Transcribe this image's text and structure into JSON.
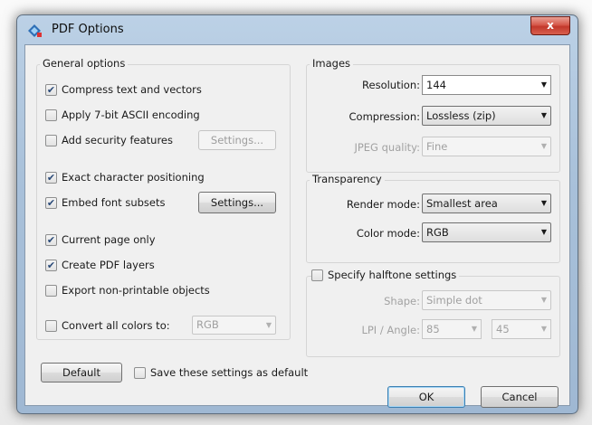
{
  "window": {
    "title": "PDF Options",
    "close_glyph": "x"
  },
  "general": {
    "title": "General options",
    "compress": {
      "label": "Compress text and vectors",
      "checked": true
    },
    "ascii": {
      "label": "Apply 7-bit ASCII encoding",
      "checked": false
    },
    "security": {
      "label": "Add security features",
      "checked": false,
      "button": "Settings..."
    },
    "exact": {
      "label": "Exact character positioning",
      "checked": true
    },
    "embed": {
      "label": "Embed font subsets",
      "checked": true,
      "button": "Settings..."
    },
    "current_page": {
      "label": "Current page only",
      "checked": true
    },
    "layers": {
      "label": "Create PDF layers",
      "checked": true
    },
    "nonprintable": {
      "label": "Export non-printable objects",
      "checked": false
    },
    "convert": {
      "label": "Convert all colors to:",
      "checked": false,
      "value": "RGB"
    }
  },
  "images": {
    "title": "Images",
    "resolution_label": "Resolution:",
    "resolution_value": "144",
    "compression_label": "Compression:",
    "compression_value": "Lossless (zip)",
    "jpeg_label": "JPEG quality:",
    "jpeg_value": "Fine"
  },
  "transparency": {
    "title": "Transparency",
    "render_label": "Render mode:",
    "render_value": "Smallest area",
    "color_label": "Color mode:",
    "color_value": "RGB"
  },
  "halftone": {
    "label": "Specify halftone settings",
    "checked": false,
    "shape_label": "Shape:",
    "shape_value": "Simple dot",
    "lpi_label": "LPI / Angle:",
    "lpi_value": "85",
    "angle_value": "45"
  },
  "footer": {
    "default_button": "Default",
    "save_default": {
      "label": "Save these settings as default",
      "checked": false
    },
    "ok_button": "OK",
    "cancel_button": "Cancel"
  },
  "colors": {
    "accent": "#3c7fb1",
    "title_bar": "#a9c1da",
    "close_button": "#c2382b"
  },
  "icons": {
    "check": "check-mark",
    "arrow": "dropdown-arrow",
    "app": "pdf-app-icon"
  }
}
